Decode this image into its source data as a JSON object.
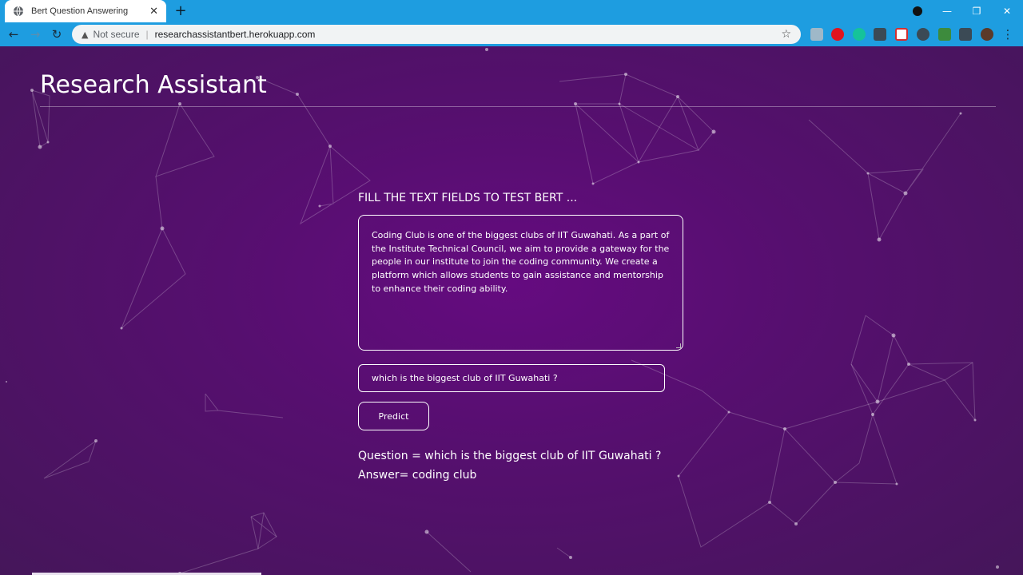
{
  "browser": {
    "tab_title": "Bert Question Answering",
    "tab_close": "✕",
    "new_tab": "+",
    "security_label": "Not secure",
    "url": "researchassistantbert.herokuapp.com",
    "window_controls": {
      "minimize": "—",
      "restore": "❐",
      "close": "✕"
    }
  },
  "page": {
    "site_title": "Research Assistant",
    "form_heading": "FILL THE TEXT FIELDS TO TEST BERT ...",
    "context_text": " Coding Club is one of the biggest clubs of IIT Guwahati. As a part of the Institute Technical Council, we aim to provide a gateway for the people in our institute to join the coding community. We create a platform which allows students to gain assistance and mentorship to enhance their coding ability.",
    "question_value": "which is the biggest club of IIT Guwahati ?",
    "predict_label": "Predict",
    "result_question": "Question = which is the biggest club of IIT Guwahati ?",
    "result_answer": "Answer= coding club"
  },
  "colors": {
    "chrome_accent": "#1e9de0",
    "page_background": "#5a0f72"
  }
}
